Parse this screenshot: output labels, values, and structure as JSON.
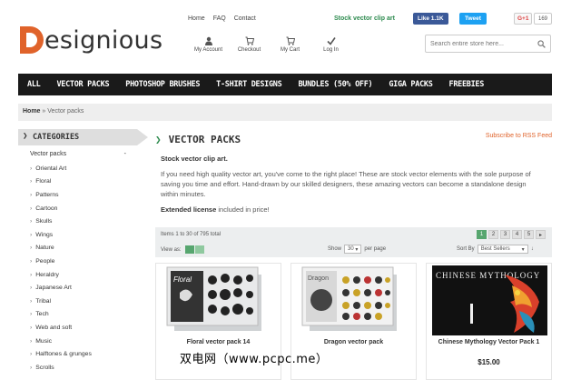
{
  "brand": {
    "logo_text": "esignious",
    "logo_initial": "D",
    "accent": "#e0632b"
  },
  "toplinks": [
    "Home",
    "FAQ",
    "Contact"
  ],
  "tagline": "Stock vector clip art",
  "iconbar": [
    {
      "label": "My Account",
      "icon": "user-icon"
    },
    {
      "label": "Checkout",
      "icon": "cart-icon"
    },
    {
      "label": "My Cart",
      "icon": "cart-icon"
    },
    {
      "label": "Log In",
      "icon": "check-icon"
    }
  ],
  "social": {
    "fb_label": "Like 1.1K",
    "tw_label": "Tweet",
    "gp_label": "G+1",
    "gp_count": "169"
  },
  "search": {
    "placeholder": "Search entire store here..."
  },
  "nav": [
    "ALL",
    "VECTOR PACKS",
    "PHOTOSHOP BRUSHES",
    "T-SHIRT DESIGNS",
    "BUNDLES (50% OFF)",
    "GIGA PACKS",
    "FREEBIES"
  ],
  "breadcrumb": {
    "home": "Home",
    "sep": "»",
    "current": "Vector packs"
  },
  "sidebar": {
    "heading": "CATEGORIES",
    "root": "Vector packs",
    "root_toggle": "-",
    "items": [
      "Oriental Art",
      "Floral",
      "Patterns",
      "Cartoon",
      "Skulls",
      "Wings",
      "Nature",
      "People",
      "Heraldry",
      "Japanese Art",
      "Tribal",
      "Tech",
      "Web and soft",
      "Music",
      "Halftones & grunges",
      "Scrolls"
    ]
  },
  "main": {
    "title": "VECTOR PACKS",
    "rss": "Subscribe to RSS Feed",
    "subtitle": "Stock vector clip art.",
    "description": "If you need high quality vector art, you've come to the right place! These are stock vector elements with the sole purpose of saving you time and effort. Hand-drawn by our skilled designers, these amazing vectors can become a standalone design within minutes.",
    "license_bold": "Extended license",
    "license_rest": " included in price!"
  },
  "toolbar": {
    "items_text": "Items 1 to 30 of 795 total",
    "pages": [
      "1",
      "2",
      "3",
      "4",
      "5",
      "▸"
    ],
    "active_page": "1",
    "view_as": "View as:",
    "show_label": "Show",
    "show_value": "30",
    "per_page": "per page",
    "sort_label": "Sort By",
    "sort_value": "Best Sellers"
  },
  "products": [
    {
      "name": "Floral vector pack 14",
      "box_label": "Floral",
      "price": ""
    },
    {
      "name": "Dragon vector pack",
      "box_label": "Dragon",
      "price": ""
    },
    {
      "name": "Chinese Mythology Vector Pack 1",
      "box_label": "CHINESE MYTHOLOGY",
      "price": "$15.00"
    }
  ],
  "watermark": "双电网（www.pcpc.me）"
}
